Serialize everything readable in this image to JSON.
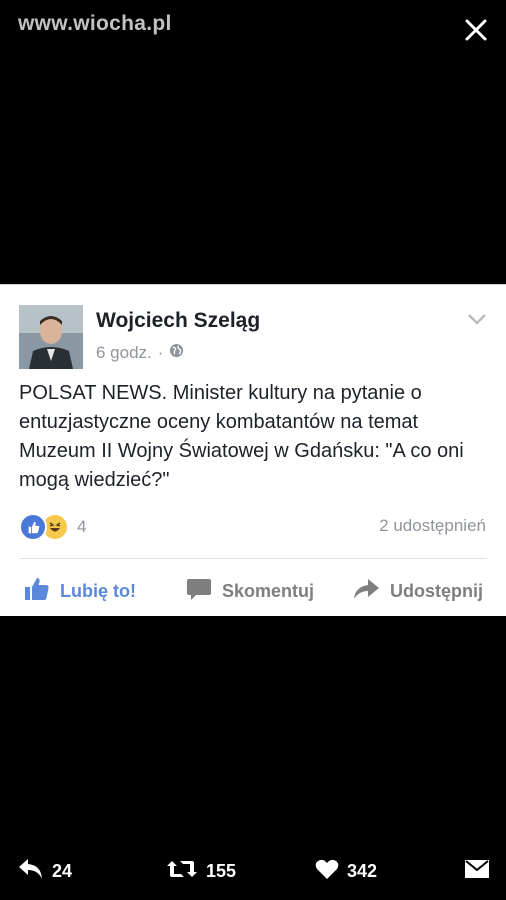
{
  "watermark": "www.wiocha.pl",
  "post": {
    "author": "Wojciech Szeląg",
    "time": "6 godz.",
    "separator": "·",
    "text": "POLSAT NEWS. Minister kultury na pytanie o entuzjastyczne oceny kombatantów na temat Muzeum II Wojny Światowej w Gdańsku: \"A co oni mogą wiedzieć?\"",
    "reactions_count": "4",
    "shares": "2 udostępnień",
    "actions": {
      "like": "Lubię to!",
      "comment": "Skomentuj",
      "share": "Udostępnij"
    }
  },
  "bottom_bar": {
    "replies": "24",
    "retweets": "155",
    "likes": "342"
  },
  "colors": {
    "background": "#000000",
    "facebook_blue": "#5b88db",
    "meta_gray": "#90949c"
  },
  "icons": [
    "close-icon",
    "chevron-down-icon",
    "globe-icon",
    "like-reaction-icon",
    "haha-reaction-icon",
    "thumbs-up-icon",
    "comment-icon",
    "share-icon",
    "reply-icon",
    "retweet-icon",
    "heart-icon",
    "message-icon"
  ]
}
